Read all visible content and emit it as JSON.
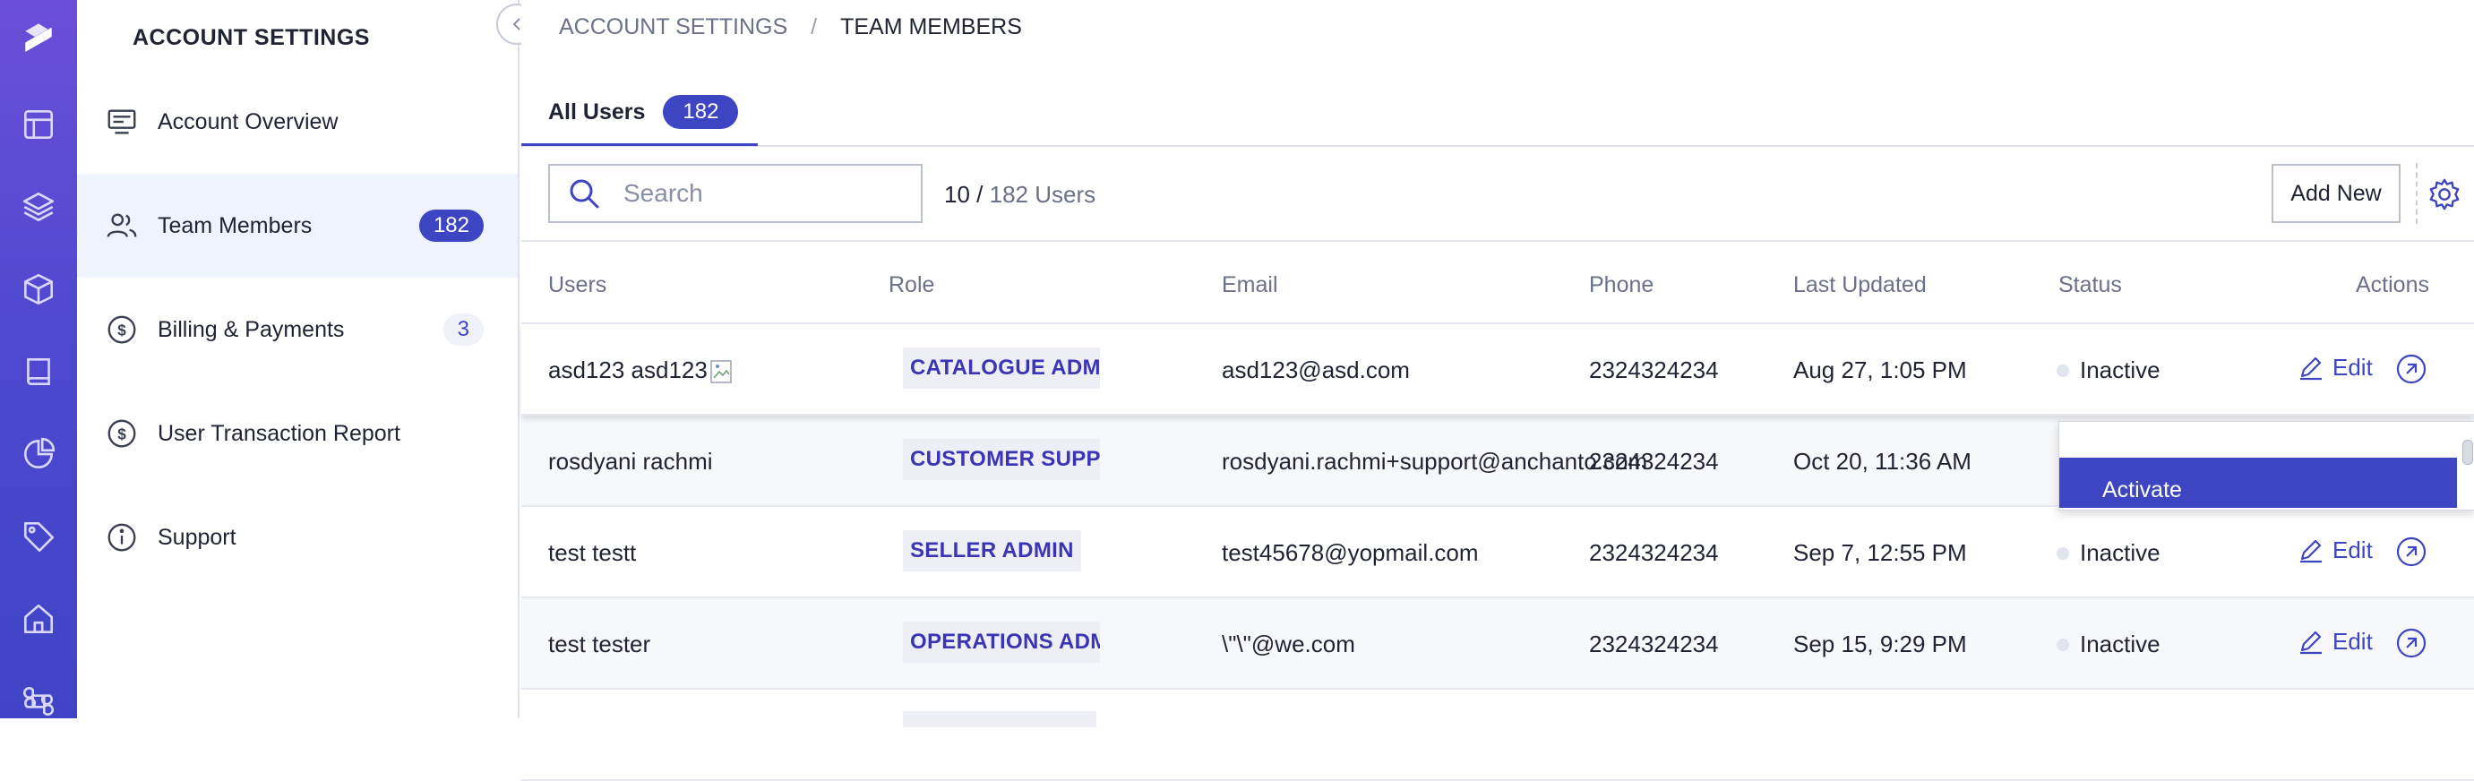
{
  "sidebar": {
    "title": "ACCOUNT SETTINGS",
    "items": [
      {
        "label": "Account Overview",
        "icon": "monitor-icon"
      },
      {
        "label": "Team Members",
        "icon": "users-icon",
        "count": "182"
      },
      {
        "label": "Billing & Payments",
        "icon": "dollar-circle-icon",
        "count": "3"
      },
      {
        "label": "User Transaction Report",
        "icon": "dollar-circle-icon"
      },
      {
        "label": "Support",
        "icon": "info-icon"
      }
    ]
  },
  "breadcrumb": {
    "parent": "ACCOUNT SETTINGS",
    "separator": "/",
    "current": "TEAM MEMBERS"
  },
  "tabs": [
    {
      "label": "All Users",
      "count": "182"
    }
  ],
  "toolbar": {
    "search_placeholder": "Search",
    "shown": "10 /",
    "total": "182 Users",
    "add_new": "Add New"
  },
  "table": {
    "headers": [
      "Users",
      "Role",
      "Email",
      "Phone",
      "Last Updated",
      "Status",
      "Actions"
    ],
    "rows": [
      {
        "user": "asd123 asd123",
        "role": "CATALOGUE ADMIN",
        "email": "asd123@asd.com",
        "phone": "2324324234",
        "updated": "Aug 27, 1:05 PM",
        "status": "Inactive",
        "edit": "Edit"
      },
      {
        "user": "rosdyani rachmi",
        "role": "CUSTOMER SUPPORT",
        "email": "rosdyani.rachmi+support@anchanto.com",
        "phone": "2324324234",
        "updated": "Oct 20, 11:36 AM",
        "status": "",
        "edit": ""
      },
      {
        "user": "test testt",
        "role": "SELLER ADMIN",
        "email": "test45678@yopmail.com",
        "phone": "2324324234",
        "updated": "Sep 7, 12:55 PM",
        "status": "Inactive",
        "edit": "Edit"
      },
      {
        "user": "test tester",
        "role": "OPERATIONS ADMIN",
        "email": "\\\"\\\"@we.com",
        "phone": "2324324234",
        "updated": "Sep 15, 9:29 PM",
        "status": "Inactive",
        "edit": "Edit"
      }
    ]
  },
  "status_dropdown": {
    "option": "Activate"
  },
  "colors": {
    "accent": "#3e45c2",
    "rail_top": "#6b4fd8",
    "rail_bottom": "#3f44c6",
    "active_bg": "#eef3fd"
  }
}
